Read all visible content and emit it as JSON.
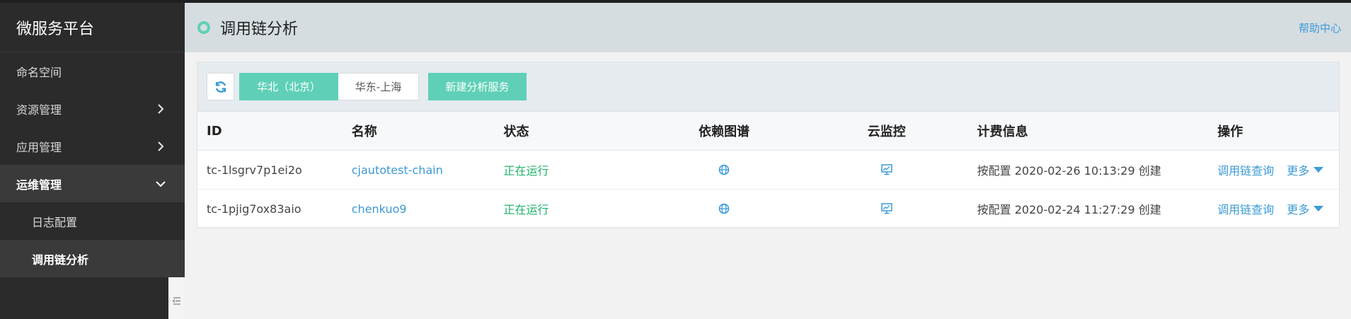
{
  "sidebar": {
    "brand": "微服务平台",
    "items": [
      {
        "label": "命名空间"
      },
      {
        "label": "资源管理"
      },
      {
        "label": "应用管理"
      },
      {
        "label": "运维管理"
      }
    ],
    "sub_items": [
      {
        "label": "日志配置"
      },
      {
        "label": "调用链分析"
      }
    ]
  },
  "header": {
    "title": "调用链分析",
    "help": "帮助中心"
  },
  "toolbar": {
    "regions": [
      "华北（北京）",
      "华东-上海"
    ],
    "new_service": "新建分析服务"
  },
  "table": {
    "columns": [
      "ID",
      "名称",
      "状态",
      "依赖图谱",
      "云监控",
      "计费信息",
      "操作"
    ],
    "rows": [
      {
        "id": "tc-1lsgrv7p1ei2o",
        "name": "cjautotest-chain",
        "status": "正在运行",
        "billing": "按配置 2020-02-26 10:13:29 创建",
        "op_query": "调用链查询",
        "op_more": "更多"
      },
      {
        "id": "tc-1pjig7ox83aio",
        "name": "chenkuo9",
        "status": "正在运行",
        "billing": "按配置 2020-02-24 11:27:29 创建",
        "op_query": "调用链查询",
        "op_more": "更多"
      }
    ]
  },
  "colors": {
    "accent": "#5fd0b7",
    "link": "#3c9ad6",
    "running": "#21b36b",
    "sidebar_bg": "#2b2b2b"
  },
  "icons": {
    "refresh": "refresh-icon",
    "dependency": "globe-network-icon",
    "monitor": "monitor-chart-icon",
    "collapse": "collapse-sidebar-icon"
  }
}
